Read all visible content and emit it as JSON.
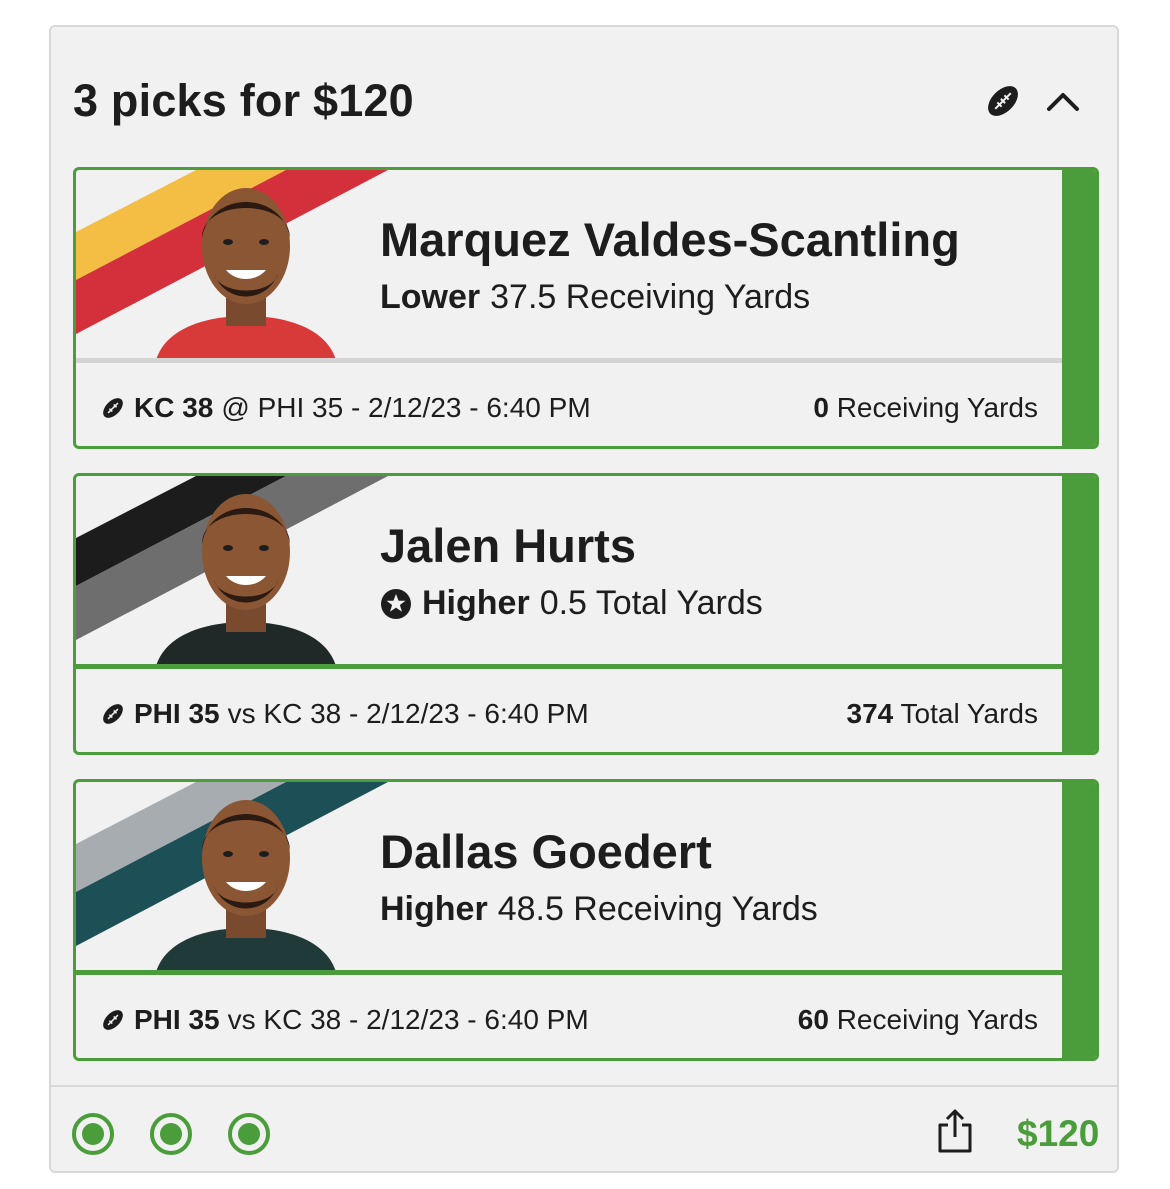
{
  "header": {
    "title": "3 picks for $120",
    "sport_icon": "football-icon",
    "collapse_icon": "chevron-up-icon"
  },
  "colors": {
    "accent_green": "#4a9d3a",
    "card_bg": "#f1f1f1"
  },
  "picks": [
    {
      "player": "Marquez Valdes-Scantling",
      "direction": "Lower",
      "line": "37.5 Receiving Yards",
      "has_star": false,
      "team1": "KC 38",
      "matchup": "@ PHI 35 - 2/12/23 - 6:40 PM",
      "result_value": "0",
      "result_stat": "Receiving Yards",
      "team_colors": [
        "#f4bd44",
        "#d3303c"
      ],
      "jersey_color": "#d83a3a",
      "divider_color": "#d4d4d4"
    },
    {
      "player": "Jalen Hurts",
      "direction": "Higher",
      "line": "0.5 Total Yards",
      "has_star": true,
      "team1": "PHI 35",
      "matchup": "vs KC 38 - 2/12/23 - 6:40 PM",
      "result_value": "374",
      "result_stat": "Total Yards",
      "team_colors": [
        "#1c1c1c",
        "#6e6e6e"
      ],
      "jersey_color": "#1f2a28",
      "divider_color": "#4a9d3a"
    },
    {
      "player": "Dallas Goedert",
      "direction": "Higher",
      "line": "48.5 Receiving Yards",
      "has_star": false,
      "team1": "PHI 35",
      "matchup": "vs KC 38 - 2/12/23 - 6:40 PM",
      "result_value": "60",
      "result_stat": "Receiving Yards",
      "team_colors": [
        "#a6acaf",
        "#1d4f57"
      ],
      "jersey_color": "#1f3a38",
      "divider_color": "#4a9d3a"
    }
  ],
  "footer": {
    "status_dots": [
      "won",
      "won",
      "won"
    ],
    "share_icon": "share-icon",
    "payout": "$120"
  }
}
